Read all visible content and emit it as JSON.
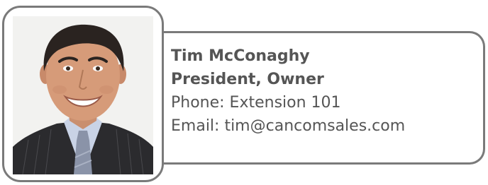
{
  "contact": {
    "name": "Tim McConaghy",
    "title": "President, Owner",
    "phone_line": "Phone: Extension 101",
    "email_line": "Email: tim@cancomsales.com"
  },
  "colors": {
    "border": "#7a7a7a",
    "text": "#555555",
    "background": "#ffffff"
  },
  "photo": {
    "description_icon": "portrait-photo"
  }
}
